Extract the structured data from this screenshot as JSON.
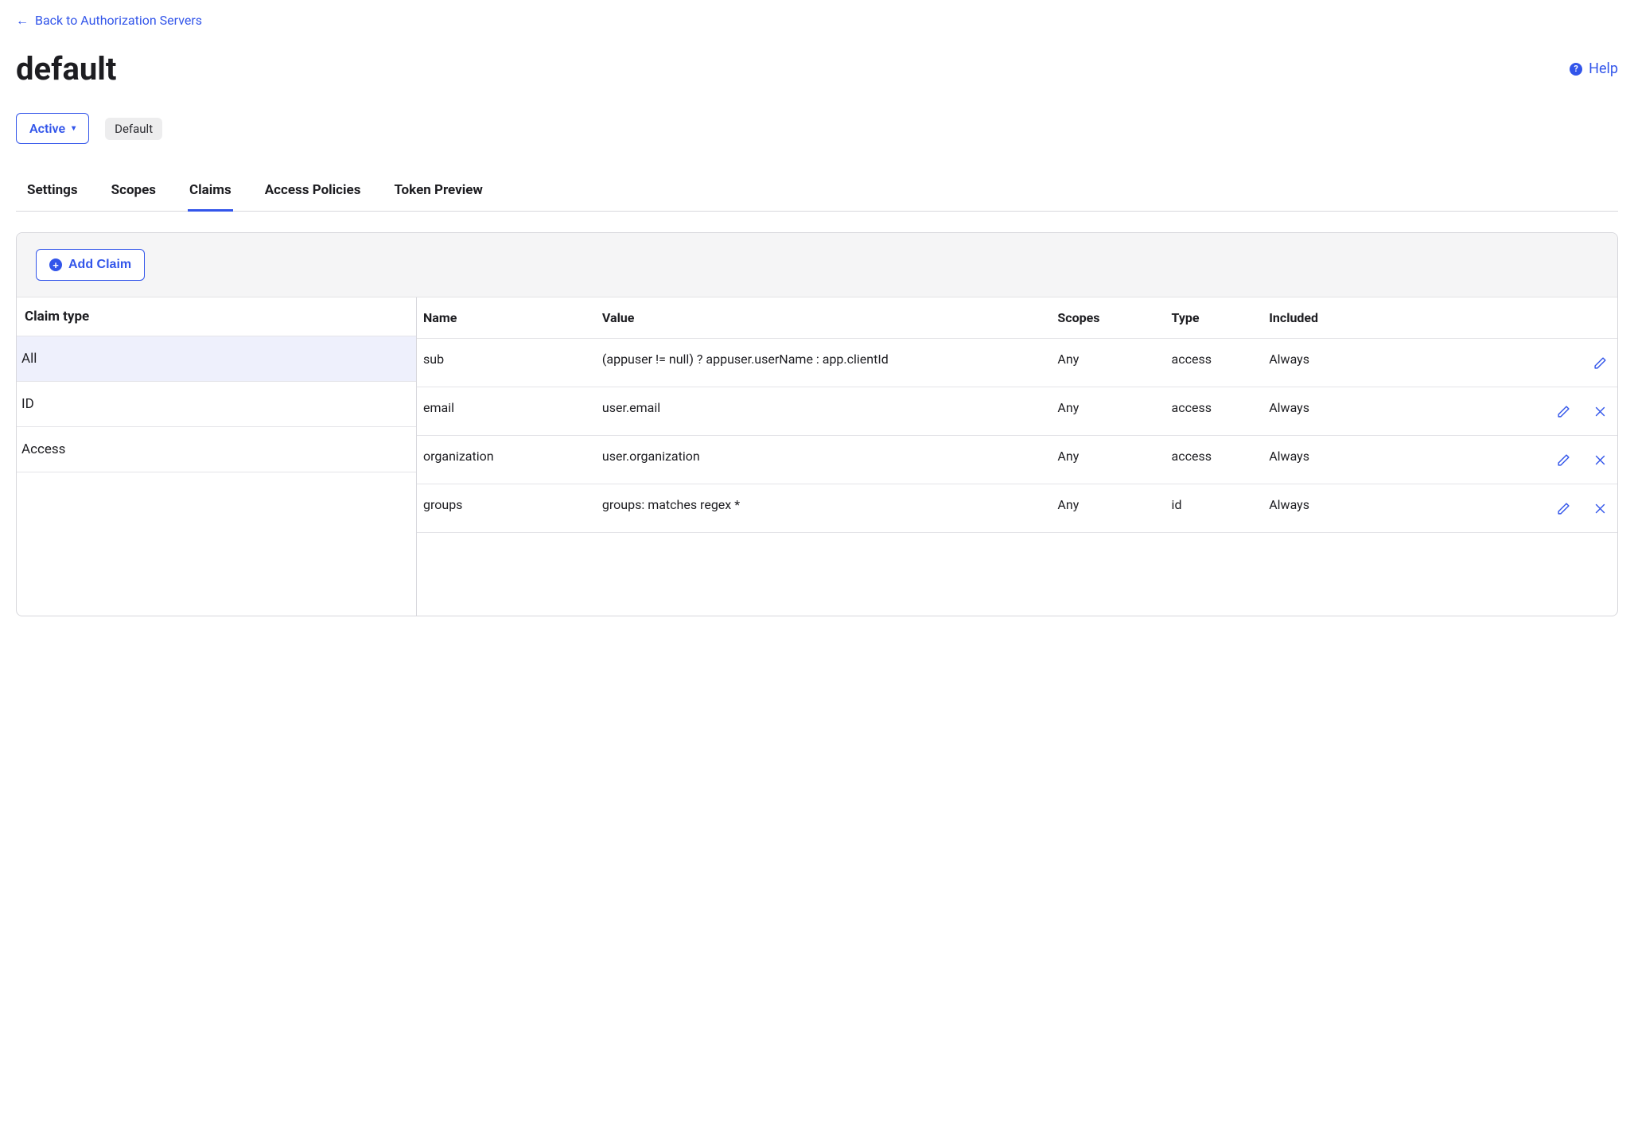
{
  "back_link": "Back to Authorization Servers",
  "page_title": "default",
  "help_label": "Help",
  "status": {
    "label": "Active",
    "badge": "Default"
  },
  "tabs": [
    {
      "label": "Settings",
      "active": false
    },
    {
      "label": "Scopes",
      "active": false
    },
    {
      "label": "Claims",
      "active": true
    },
    {
      "label": "Access Policies",
      "active": false
    },
    {
      "label": "Token Preview",
      "active": false
    }
  ],
  "add_button": "Add Claim",
  "sidebar": {
    "header": "Claim type",
    "items": [
      {
        "label": "All",
        "selected": true
      },
      {
        "label": "ID",
        "selected": false
      },
      {
        "label": "Access",
        "selected": false
      }
    ]
  },
  "columns": {
    "name": "Name",
    "value": "Value",
    "scopes": "Scopes",
    "type": "Type",
    "included": "Included"
  },
  "rows": [
    {
      "name": "sub",
      "value": "(appuser != null) ? appuser.userName : app.clientId",
      "scopes": "Any",
      "type": "access",
      "included": "Always",
      "deletable": false
    },
    {
      "name": "email",
      "value": "user.email",
      "scopes": "Any",
      "type": "access",
      "included": "Always",
      "deletable": true
    },
    {
      "name": "organization",
      "value": "user.organization",
      "scopes": "Any",
      "type": "access",
      "included": "Always",
      "deletable": true
    },
    {
      "name": "groups",
      "value": "groups: matches regex *",
      "scopes": "Any",
      "type": "id",
      "included": "Always",
      "deletable": true
    }
  ]
}
